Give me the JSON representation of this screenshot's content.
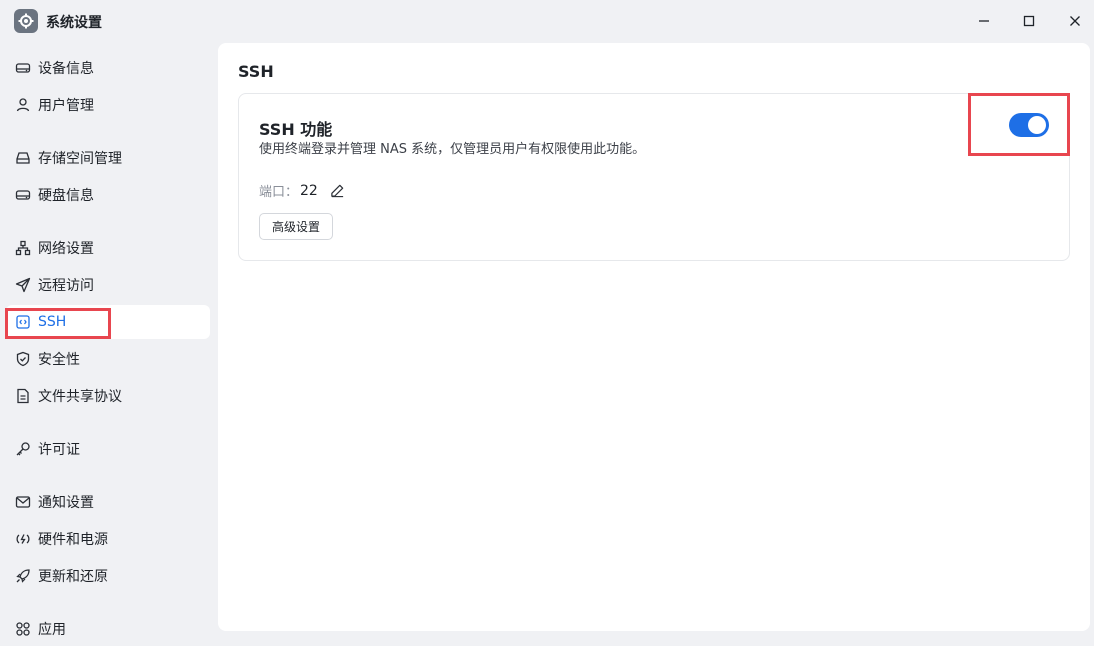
{
  "window": {
    "title": "系统设置"
  },
  "sidebar": {
    "items": [
      {
        "label": "设备信息",
        "icon": "drive-icon"
      },
      {
        "label": "用户管理",
        "icon": "user-icon"
      },
      {
        "label": "存储空间管理",
        "icon": "storage-icon"
      },
      {
        "label": "硬盘信息",
        "icon": "disk-icon"
      },
      {
        "label": "网络设置",
        "icon": "network-icon"
      },
      {
        "label": "远程访问",
        "icon": "send-icon"
      },
      {
        "label": "SSH",
        "icon": "code-icon",
        "active": true
      },
      {
        "label": "安全性",
        "icon": "shield-icon"
      },
      {
        "label": "文件共享协议",
        "icon": "file-icon"
      },
      {
        "label": "许可证",
        "icon": "key-icon"
      },
      {
        "label": "通知设置",
        "icon": "mail-icon"
      },
      {
        "label": "硬件和电源",
        "icon": "power-icon"
      },
      {
        "label": "更新和还原",
        "icon": "rocket-icon"
      },
      {
        "label": "应用",
        "icon": "apps-icon"
      }
    ]
  },
  "main": {
    "title": "SSH",
    "ssh_card": {
      "title": "SSH 功能",
      "description": "使用终端登录并管理 NAS 系统，仅管理员用户有权限使用此功能。",
      "enabled": true,
      "port_label": "端口：",
      "port_value": "22",
      "advanced_button": "高级设置"
    }
  },
  "colors": {
    "accent": "#1e6fe6",
    "highlight": "#e8464f"
  }
}
